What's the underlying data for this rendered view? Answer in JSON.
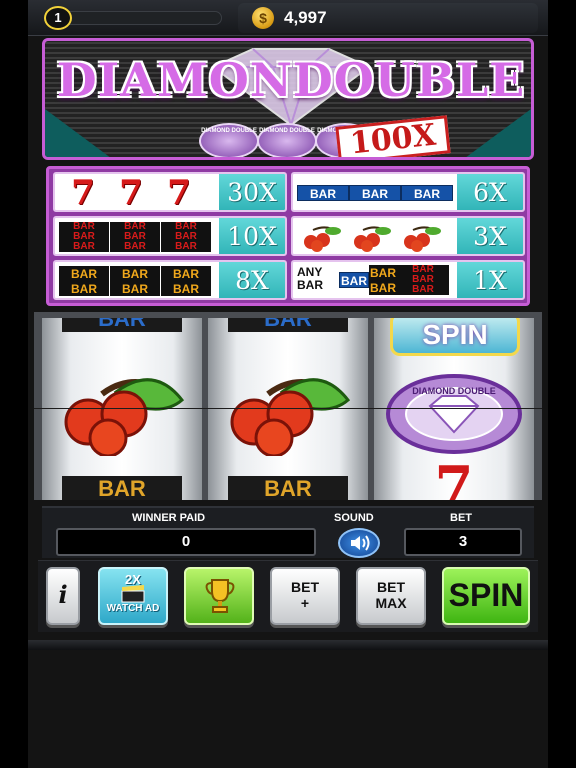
{
  "topbar": {
    "level": "1",
    "coins": "4,997",
    "coin_symbol": "$"
  },
  "title": {
    "text": "DIAMONDOUBLE",
    "multiplier": "100X",
    "badge_text": "DIAMOND DOUBLE"
  },
  "paytable": {
    "rows": [
      {
        "symbols": "7 7 7",
        "multiplier": "30X"
      },
      {
        "symbols": "BAR BAR BAR",
        "multiplier": "6X"
      },
      {
        "symbols": "3BAR 3BAR 3BAR",
        "multiplier": "10X"
      },
      {
        "symbols": "cherry cherry cherry",
        "multiplier": "3X"
      },
      {
        "symbols": "2BAR 2BAR 2BAR",
        "multiplier": "8X"
      },
      {
        "symbols": "ANY BAR",
        "multiplier": "1X"
      }
    ],
    "seven": "7",
    "bar": "BAR",
    "any": "ANY",
    "any_bar": "BAR"
  },
  "reels": {
    "reel1": {
      "top": "BAR",
      "bottom": "BAR"
    },
    "reel2": {
      "top": "BAR",
      "bottom": "BAR"
    },
    "reel3": {
      "top": "SPIN",
      "middle": "DIAMOND DOUBLE",
      "bottom": "7"
    }
  },
  "info": {
    "winner_paid_label": "WINNER PAID",
    "winner_paid": "0",
    "sound_label": "SOUND",
    "bet_label": "BET",
    "bet": "3"
  },
  "buttons": {
    "info": "i",
    "watch_multiplier": "2X",
    "watch_ad": "WATCH AD",
    "bet_plus_1": "BET",
    "bet_plus_2": "+",
    "bet_max_1": "BET",
    "bet_max_2": "MAX",
    "spin": "SPIN"
  },
  "colors": {
    "accent_purple": "#c65dd5",
    "teal": "#2fb3b6",
    "spin_green": "#3fb512",
    "coin_gold": "#d79a13"
  }
}
